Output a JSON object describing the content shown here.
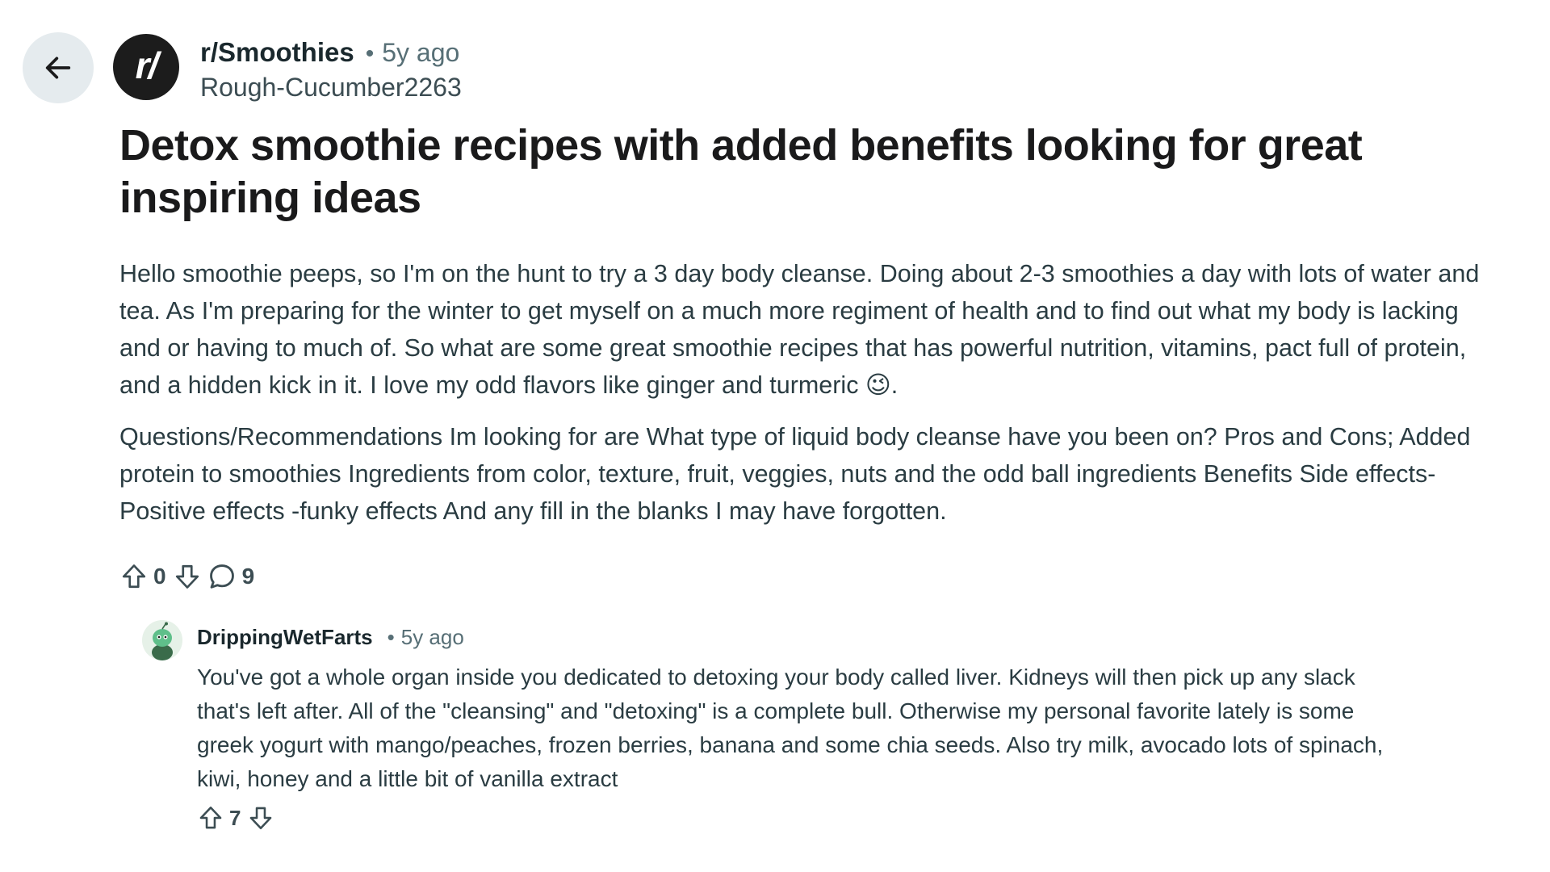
{
  "header": {
    "back_icon": "arrow-left-icon",
    "subreddit_logo_text": "r/",
    "subreddit": "r/Smoothies",
    "separator": "•",
    "time_ago": "5y ago",
    "author": "Rough-Cucumber2263"
  },
  "post": {
    "title": "Detox smoothie recipes with added benefits looking for great inspiring ideas",
    "paragraphs": [
      "Hello smoothie peeps, so I'm on the hunt to try a 3 day body cleanse. Doing about 2-3 smoothies a day with lots of water and tea. As I'm preparing for the winter to get myself on a much more regiment of health and to find out what my body is lacking and or having to much of. So what are some great smoothie recipes that has powerful nutrition, vitamins, pact full of protein, and a hidden kick in it. I love my odd flavors like ginger and turmeric 😉.",
      "Questions/Recommendations Im looking for are What type of liquid body cleanse have you been on? Pros and Cons; Added protein to smoothies Ingredients from color, texture, fruit, veggies, nuts and the odd ball ingredients Benefits Side effects- Positive effects -funky effects And any fill in the blanks I may have forgotten."
    ],
    "upvote_count": "0",
    "comment_count": "9"
  },
  "comment": {
    "author": "DrippingWetFarts",
    "separator": "•",
    "time_ago": "5y ago",
    "body": "You've got a whole organ inside you dedicated to detoxing your body called liver. Kidneys will then pick up any slack that's left after. All of the \"cleansing\" and \"detoxing\" is a complete bull. Otherwise my personal favorite lately is some greek yogurt with mango/peaches, frozen berries, banana and some chia seeds. Also try milk, avocado lots of spinach, kiwi, honey and a little bit of vanilla extract",
    "upvote_count": "7"
  },
  "colors": {
    "back_button_bg": "#e5ebee",
    "subreddit_logo_bg": "#1c1c1c",
    "meta_text": "#576f76",
    "body_text": "#2a3c42"
  }
}
